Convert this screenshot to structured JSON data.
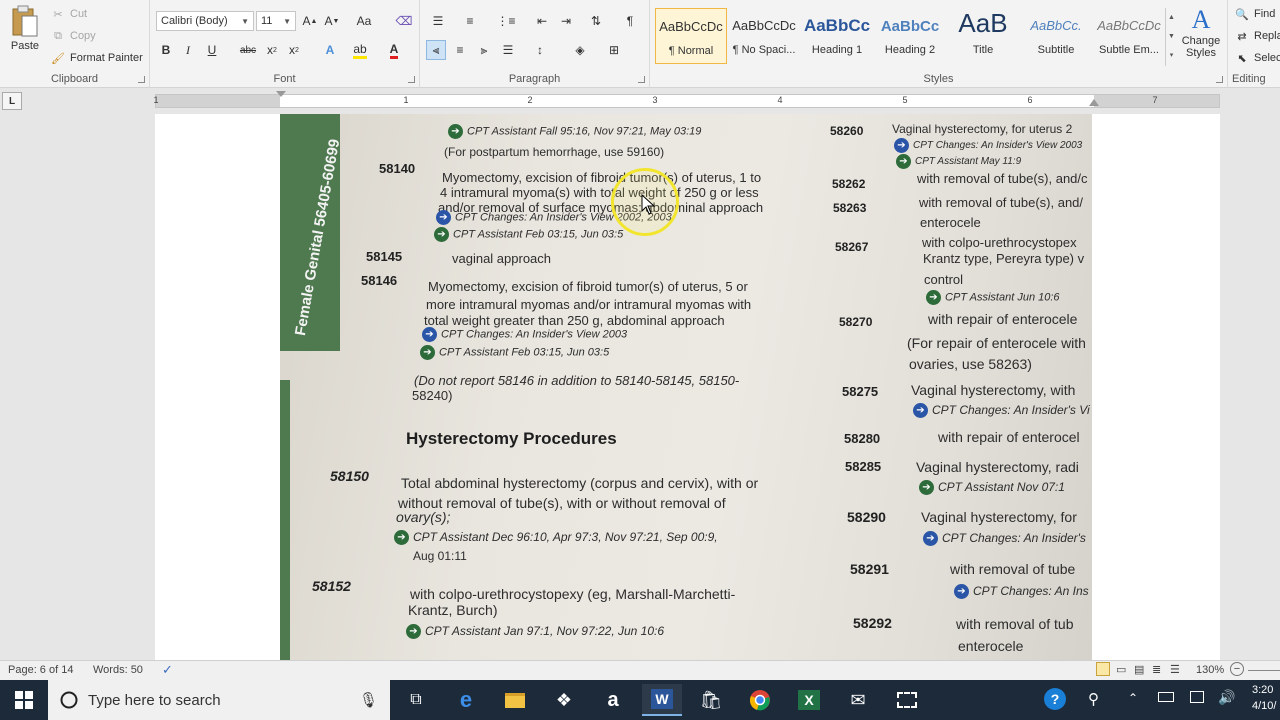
{
  "ribbon": {
    "clipboard": {
      "label": "Clipboard",
      "paste": "Paste",
      "cut": "Cut",
      "copy": "Copy",
      "format_painter": "Format Painter"
    },
    "font": {
      "label": "Font",
      "name": "Calibri (Body)",
      "size": "11"
    },
    "paragraph": {
      "label": "Paragraph"
    },
    "styles": {
      "label": "Styles",
      "items": [
        {
          "preview": "AaBbCcDc",
          "name": "¶ Normal"
        },
        {
          "preview": "AaBbCcDc",
          "name": "¶ No Spaci..."
        },
        {
          "preview": "AaBbCc",
          "name": "Heading 1"
        },
        {
          "preview": "AaBbCc",
          "name": "Heading 2"
        },
        {
          "preview": "AaB",
          "name": "Title"
        },
        {
          "preview": "AaBbCc.",
          "name": "Subtitle"
        },
        {
          "preview": "AaBbCcDc",
          "name": "Subtle Em..."
        }
      ],
      "change_styles": "Change Styles"
    },
    "editing": {
      "label": "Editing",
      "find": "Find",
      "replace": "Repla",
      "select": "Selec"
    }
  },
  "ruler": {
    "numbers": [
      "1",
      "1",
      "2",
      "3",
      "4",
      "5",
      "6",
      "7"
    ],
    "tab_selector": "L"
  },
  "document": {
    "sidebar_text": "Female Genital 56405-60699",
    "left_column": [
      {
        "kind": "ref",
        "text": "CPT Assistant Fall 95:16, Nov 97:21, May 03:19"
      },
      {
        "kind": "note",
        "text": "(For postpartum hemorrhage, use 59160)"
      },
      {
        "code": "58140",
        "lines": [
          "Myomectomy, excision of fibroid tumor(s) of uterus, 1 to",
          "4 intramural myoma(s) with total weight of 250 g or less",
          "and/or removal of surface myomas; abdominal approach"
        ]
      },
      {
        "kind": "change",
        "text": "CPT Changes: An Insider's View 2002, 2003"
      },
      {
        "kind": "ref",
        "text": "CPT Assistant Feb 03:15, Jun 03:5"
      },
      {
        "code": "58145",
        "lines": [
          "vaginal approach"
        ]
      },
      {
        "code": "58146",
        "lines": [
          "Myomectomy, excision of fibroid tumor(s) of uterus, 5 or",
          "more intramural myomas and/or intramural myomas with",
          "total weight greater than 250 g, abdominal approach"
        ]
      },
      {
        "kind": "change",
        "text": "CPT Changes: An Insider's View 2003"
      },
      {
        "kind": "ref",
        "text": "CPT Assistant Feb 03:15, Jun 03:5"
      },
      {
        "kind": "note",
        "text": "(Do not report 58146 in addition to 58140-58145, 58150-",
        "text2": "58240)"
      },
      {
        "kind": "heading",
        "text": "Hysterectomy Procedures"
      },
      {
        "code": "58150",
        "lines": [
          "Total abdominal hysterectomy (corpus and cervix), with or",
          "without removal of tube(s), with or without removal of",
          "ovary(s);"
        ]
      },
      {
        "kind": "ref",
        "text": "CPT Assistant Dec 96:10, Apr 97:3, Nov 97:21, Sep 00:9,",
        "text2": "Aug 01:11"
      },
      {
        "code": "58152",
        "lines": [
          "with colpo-urethrocystopexy (eg, Marshall-Marchetti-",
          "Krantz, Burch)"
        ]
      },
      {
        "kind": "ref",
        "text": "CPT Assistant Jan 97:1, Nov 97:22, Jun 10:6"
      }
    ],
    "right_column": {
      "codes": [
        "58260",
        "58262",
        "58263",
        "58267",
        "58270",
        "58275",
        "58280",
        "58285",
        "58290",
        "58291",
        "58292"
      ],
      "texts": [
        "Vaginal hysterectomy, for uterus 2",
        "CPT Changes: An Insider's View 2003",
        "CPT Assistant May 11:9",
        "with removal of tube(s), and/c",
        "with removal of tube(s), and/",
        "enterocele",
        "with colpo-urethrocystopex",
        "Krantz type, Pereyra type) v",
        "control",
        "CPT Assistant Jun 10:6",
        "with repair of enterocele",
        "(For repair of enterocele with",
        "ovaries, use 58263)",
        "Vaginal hysterectomy, with",
        "CPT Changes: An Insider's Vi",
        "with repair of enterocel",
        "Vaginal hysterectomy, radi",
        "CPT Assistant Nov 07:1",
        "Vaginal hysterectomy, for",
        "CPT Changes: An Insider's",
        "with removal of tube",
        "CPT Changes: An Ins",
        "with removal of tub",
        "enterocele"
      ]
    }
  },
  "status": {
    "page": "Page: 6 of 14",
    "words": "Words: 50",
    "zoom": "130%"
  },
  "taskbar": {
    "search_placeholder": "Type here to search",
    "time": "3:20",
    "date": "4/10/"
  }
}
